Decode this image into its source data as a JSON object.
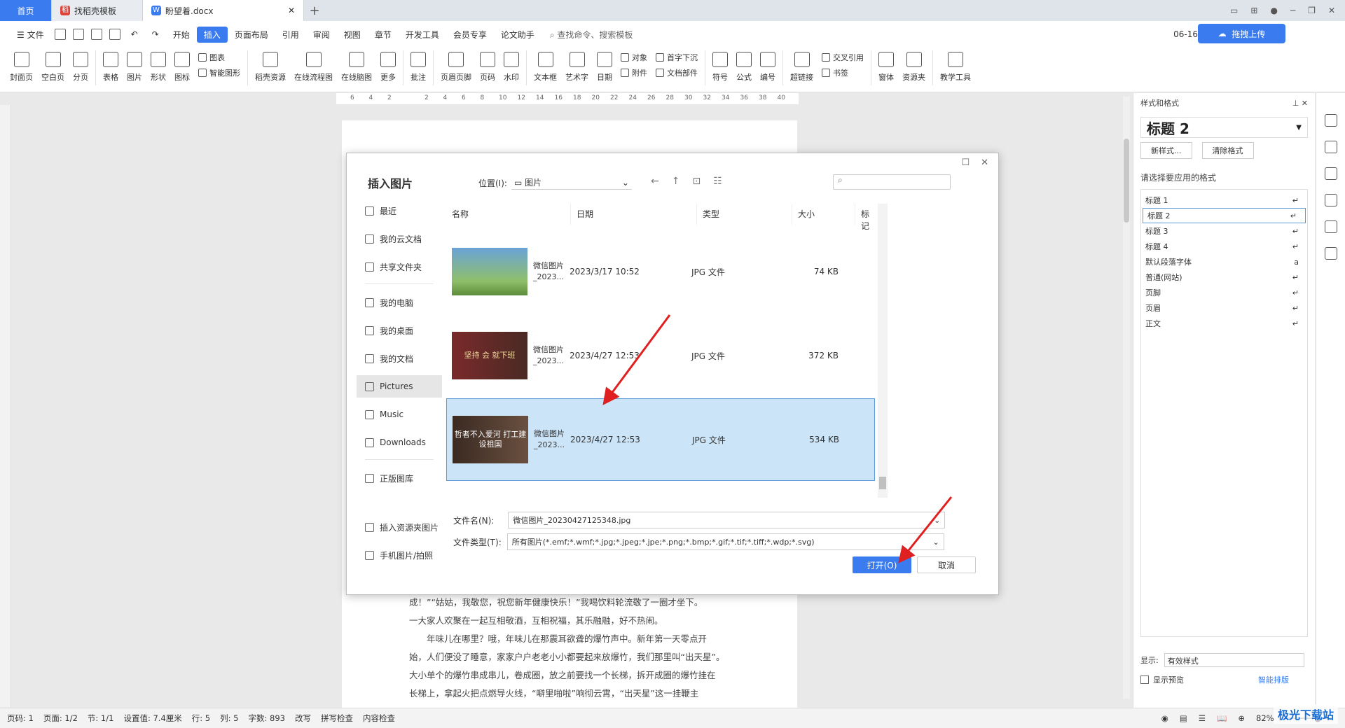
{
  "tabs": {
    "home": "首页",
    "template": "找稻壳模板",
    "doc": "盼望着.docx"
  },
  "menu": {
    "file": "文件",
    "items": [
      "开始",
      "插入",
      "页面布局",
      "引用",
      "审阅",
      "视图",
      "章节",
      "开发工具",
      "会员专享",
      "论文助手"
    ],
    "search": "查找命令、搜索模板",
    "date": "06-16",
    "cloud": "拖拽上传"
  },
  "ribbon": {
    "b1": "封面页",
    "b2": "空白页",
    "b3": "分页",
    "b4": "表格",
    "b5": "图片",
    "b6": "形状",
    "b7": "图标",
    "s1": "图表",
    "s2": "智能图形",
    "b8": "稻壳资源",
    "b9": "在线流程图",
    "b10": "在线脑图",
    "b11": "更多",
    "b12": "批注",
    "b13": "页眉页脚",
    "b14": "页码",
    "b15": "水印",
    "b16": "文本框",
    "b17": "艺术字",
    "b18": "日期",
    "s3": "对象",
    "s4": "附件",
    "s5": "首字下沉",
    "s6": "文档部件",
    "b19": "符号",
    "b20": "公式",
    "b21": "编号",
    "b22": "超链接",
    "s7": "交叉引用",
    "s8": "书签",
    "b23": "窗体",
    "b24": "资源夹",
    "b25": "教学工具"
  },
  "ruler": [
    "6",
    "4",
    "2",
    "",
    "2",
    "4",
    "6",
    "8",
    "10",
    "12",
    "14",
    "16",
    "18",
    "20",
    "22",
    "24",
    "26",
    "28",
    "30",
    "32",
    "34",
    "36",
    "38",
    "40"
  ],
  "doc": {
    "lines": [
      "成！”“姑姑，我敬您，祝您新年健康快乐！”我喝饮料轮流敬了一圈才坐下。",
      "一大家人欢聚在一起互相敬酒，互相祝福，其乐融融，好不热闹。",
      "　　年味儿在哪里？哦，年味儿在那震耳欲聋的爆竹声中。新年第一天零点开",
      "始，人们便没了睡意，家家户户老老小小都要起来放爆竹，我们那里叫“出天星”。",
      "大小单个的爆竹串成串儿，卷成圈，放之前要找一个长梯，拆开成圈的爆竹挂在",
      "长梯上，拿起火把点燃导火线，“噼里啪啦”响彻云霄，“出天星”这一挂鞭主"
    ]
  },
  "dialog": {
    "title": "插入图片",
    "location_label": "位置(I):",
    "location": "图片",
    "side": [
      "最近",
      "我的云文档",
      "共享文件夹",
      "我的电脑",
      "我的桌面",
      "我的文档",
      "Pictures",
      "Music",
      "Downloads",
      "正版图库",
      "插入资源夹图片",
      "手机图片/拍照"
    ],
    "cols": [
      "名称",
      "日期",
      "类型",
      "大小",
      "标记"
    ],
    "files": [
      {
        "name": "微信图片_2023...",
        "date": "2023/3/17 10:52",
        "type": "JPG 文件",
        "size": "74 KB",
        "thumb": ""
      },
      {
        "name": "微信图片_2023...",
        "date": "2023/4/27 12:53",
        "type": "JPG 文件",
        "size": "372 KB",
        "thumb": "坚持 会 就下班"
      },
      {
        "name": "微信图片_2023...",
        "date": "2023/4/27 12:53",
        "type": "JPG 文件",
        "size": "534 KB",
        "thumb": "哲者不入爱河 打工建设祖国"
      }
    ],
    "filename_label": "文件名(N):",
    "filename": "微信图片_20230427125348.jpg",
    "filetype_label": "文件类型(T):",
    "filetype": "所有图片(*.emf;*.wmf;*.jpg;*.jpeg;*.jpe;*.png;*.bmp;*.gif;*.tif;*.tiff;*.wdp;*.svg)",
    "open": "打开(O)",
    "cancel": "取消"
  },
  "panel": {
    "title": "样式和格式",
    "current": "标题  2",
    "new": "新样式...",
    "clear": "清除格式",
    "choose": "请选择要应用的格式",
    "styles": [
      "标题 1",
      "标题 2",
      "标题 3",
      "标题 4",
      "默认段落字体",
      "普通(网站)",
      "页脚",
      "页眉",
      "正文"
    ],
    "show_label": "显示:",
    "show": "有效样式",
    "preview": "显示预览",
    "smart": "智能排版"
  },
  "status": {
    "page": "页码: 1",
    "pages": "页面: 1/2",
    "section": "节: 1/1",
    "setting": "设置值: 7.4厘米",
    "row": "行: 5",
    "col": "列: 5",
    "words": "字数: 893",
    "revise": "改写",
    "spell": "拼写检查",
    "content": "内容检查",
    "zoom": "82%"
  },
  "watermark": "极光下载站"
}
